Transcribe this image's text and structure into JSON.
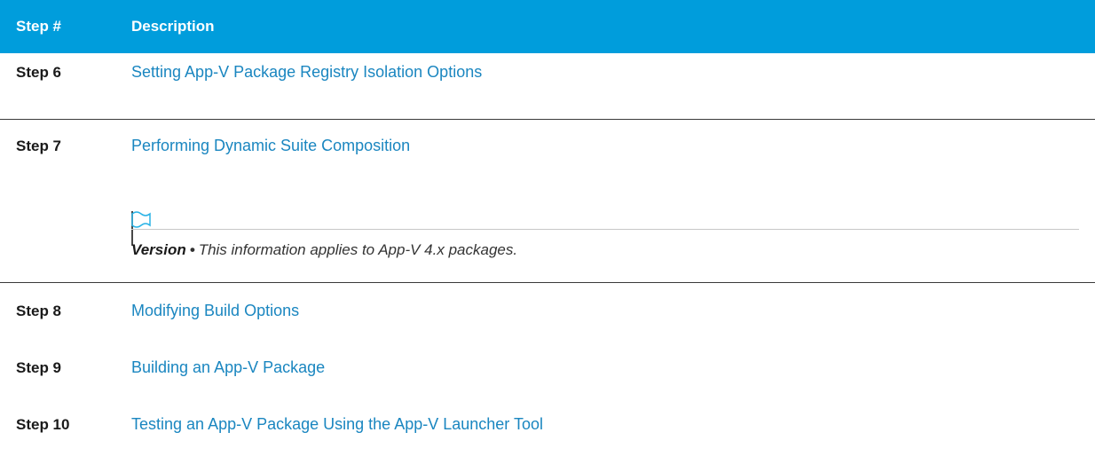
{
  "header": {
    "step_label": "Step #",
    "description_label": "Description",
    "background_color": "#009ddc"
  },
  "rows": [
    {
      "step": "Step 6",
      "link": "Setting App-V Package Registry Isolation Options"
    },
    {
      "step": "Step 7",
      "link": "Performing Dynamic Suite Composition"
    },
    {
      "step": "Step 8",
      "link": "Modifying Build Options"
    },
    {
      "step": "Step 9",
      "link": "Building an App-V Package"
    },
    {
      "step": "Step 10",
      "link": "Testing an App-V Package Using the App-V Launcher Tool"
    }
  ],
  "note": {
    "icon": "flag-icon",
    "title": "Version",
    "bullet": "•",
    "text": "This information applies to App-V 4.x packages."
  },
  "colors": {
    "link": "#1a86c0",
    "accent": "#009ddc"
  }
}
